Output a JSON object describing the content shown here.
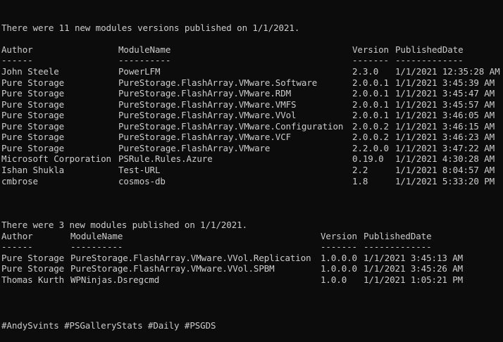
{
  "section1": {
    "summary": "There were 11 new modules versions published on 1/1/2021.",
    "headers": [
      "Author",
      "ModuleName",
      "Version",
      "PublishedDate"
    ],
    "separators": [
      "------",
      "----------",
      "-------",
      "-------------"
    ],
    "rows": [
      [
        "John Steele",
        "PowerLFM",
        "2.3.0",
        "1/1/2021 12:35:28 AM"
      ],
      [
        "Pure Storage",
        "PureStorage.FlashArray.VMware.Software",
        "2.0.0.1",
        "1/1/2021 3:45:39 AM"
      ],
      [
        "Pure Storage",
        "PureStorage.FlashArray.VMware.RDM",
        "2.0.0.1",
        "1/1/2021 3:45:47 AM"
      ],
      [
        "Pure Storage",
        "PureStorage.FlashArray.VMware.VMFS",
        "2.0.0.1",
        "1/1/2021 3:45:57 AM"
      ],
      [
        "Pure Storage",
        "PureStorage.FlashArray.VMware.VVol",
        "2.0.0.1",
        "1/1/2021 3:46:05 AM"
      ],
      [
        "Pure Storage",
        "PureStorage.FlashArray.VMware.Configuration",
        "2.0.0.2",
        "1/1/2021 3:46:15 AM"
      ],
      [
        "Pure Storage",
        "PureStorage.FlashArray.VMware.VCF",
        "2.0.0.2",
        "1/1/2021 3:46:23 AM"
      ],
      [
        "Pure Storage",
        "PureStorage.FlashArray.VMware",
        "2.2.0.0",
        "1/1/2021 3:47:22 AM"
      ],
      [
        "Microsoft Corporation",
        "PSRule.Rules.Azure",
        "0.19.0",
        "1/1/2021 4:30:28 AM"
      ],
      [
        "Ishan Shukla",
        "Test-URL",
        "2.2",
        "1/1/2021 8:04:57 AM"
      ],
      [
        "cmbrose",
        "cosmos-db",
        "1.8",
        "1/1/2021 5:33:20 PM"
      ]
    ]
  },
  "section2": {
    "summary": "There were 3 new modules published on 1/1/2021.",
    "headers": [
      "Author",
      "ModuleName",
      "Version",
      "PublishedDate"
    ],
    "separators": [
      "------",
      "----------",
      "-------",
      "-------------"
    ],
    "rows": [
      [
        "Pure Storage",
        "PureStorage.FlashArray.VMware.VVol.Replication",
        "1.0.0.0",
        "1/1/2021 3:45:13 AM"
      ],
      [
        "Pure Storage",
        "PureStorage.FlashArray.VMware.VVol.SPBM",
        "1.0.0.0",
        "1/1/2021 3:45:26 AM"
      ],
      [
        "Thomas Kurth",
        "WPNinjas.Dsregcmd",
        "1.0.0",
        "1/1/2021 1:05:21 PM"
      ]
    ]
  },
  "footer": {
    "hashtags": "#AndySvints #PSGalleryStats #Daily #PSGDS"
  },
  "colors": {
    "background": "#0c0c0c",
    "text": "#cccccc"
  }
}
